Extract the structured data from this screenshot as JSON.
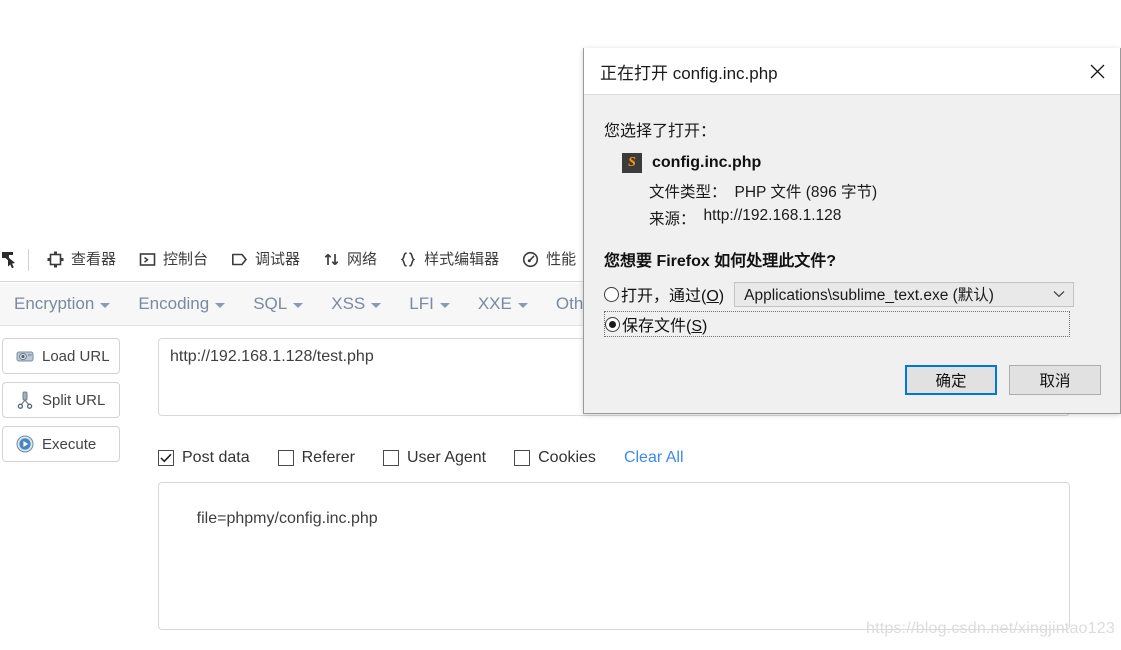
{
  "devtools": {
    "picker_icon": "element-picker-icon",
    "tabs": [
      {
        "label": "查看器",
        "icon": "inspector-icon"
      },
      {
        "label": "控制台",
        "icon": "console-icon"
      },
      {
        "label": "调试器",
        "icon": "debugger-icon"
      },
      {
        "label": "网络",
        "icon": "network-icon"
      },
      {
        "label": "样式编辑器",
        "icon": "style-editor-icon"
      },
      {
        "label": "性能",
        "icon": "performance-icon"
      }
    ]
  },
  "hackbar": {
    "menus": [
      {
        "label": "Encryption"
      },
      {
        "label": "Encoding"
      },
      {
        "label": "SQL"
      },
      {
        "label": "XSS"
      },
      {
        "label": "LFI"
      },
      {
        "label": "XXE"
      },
      {
        "label": "Othe"
      }
    ],
    "buttons": [
      {
        "label": "Load URL",
        "icon": "load-url-icon"
      },
      {
        "label": "Split URL",
        "icon": "split-url-icon"
      },
      {
        "label": "Execute",
        "icon": "execute-icon"
      }
    ],
    "url_value": "http://192.168.1.128/test.php",
    "options": [
      {
        "label": "Post data",
        "checked": true
      },
      {
        "label": "Referer",
        "checked": false
      },
      {
        "label": "User Agent",
        "checked": false
      },
      {
        "label": "Cookies",
        "checked": false
      }
    ],
    "clear_all_label": "Clear All",
    "post_data_value": "file=phpmy/config.inc.php",
    "link_color": "#3b8ce8"
  },
  "dialog": {
    "title": "正在打开 config.inc.php",
    "close_icon": "close-icon",
    "intro": "您选择了打开：",
    "file_icon_letter": "S",
    "file_icon_name": "sublime-text-file-icon",
    "file_name": "config.inc.php",
    "meta": [
      {
        "key": "文件类型：",
        "value": "PHP 文件 (896 字节)"
      },
      {
        "key": "来源：",
        "value": "http://192.168.1.128"
      }
    ],
    "question": "您想要 Firefox 如何处理此文件?",
    "open_with": {
      "label_pre": "打开，通过(",
      "label_key": "O",
      "label_post": ")",
      "selected": false,
      "app_value": "Applications\\sublime_text.exe (默认)",
      "caret_icon": "chevron-down-icon"
    },
    "save_file": {
      "label_pre": "保存文件(",
      "label_key": "S",
      "label_post": ")",
      "selected": true
    },
    "ok_label": "确定",
    "cancel_label": "取消",
    "accent_color": "#0078d7"
  },
  "watermark": {
    "text": "https://blog.csdn.net/xingjintao123"
  }
}
